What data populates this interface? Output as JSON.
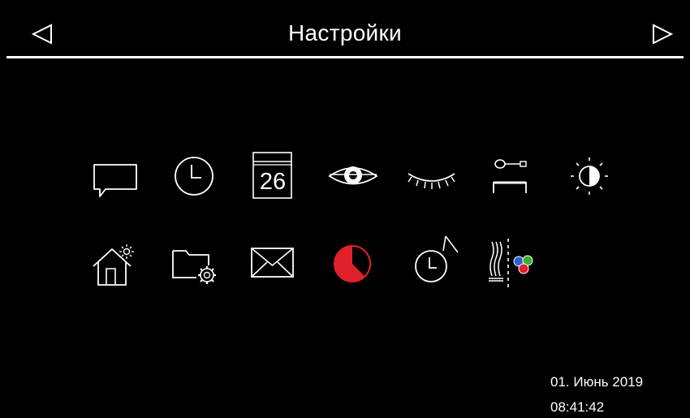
{
  "header": {
    "title": "Настройки",
    "back_icon": "triangle-left-icon",
    "forward_icon": "triangle-right-icon"
  },
  "menu": {
    "row1": [
      "message-icon",
      "clock-icon",
      "calendar-icon",
      "eye-open-icon",
      "eye-closed-icon",
      "key-lock-icon",
      "brightness-icon"
    ],
    "row2": [
      "home-sun-icon",
      "folder-settings-icon",
      "envelope-icon",
      "timer-red-icon",
      "alarm-clock-icon",
      "heating-colors-icon"
    ],
    "calendar_day": "26"
  },
  "status": {
    "date": "01. Июнь 2019",
    "time": "08:41:42"
  },
  "colors": {
    "background": "#000000",
    "foreground": "#ffffff",
    "accent_red": "#e0202a",
    "dot_blue": "#2d5fd3",
    "dot_green": "#3fae2e"
  }
}
